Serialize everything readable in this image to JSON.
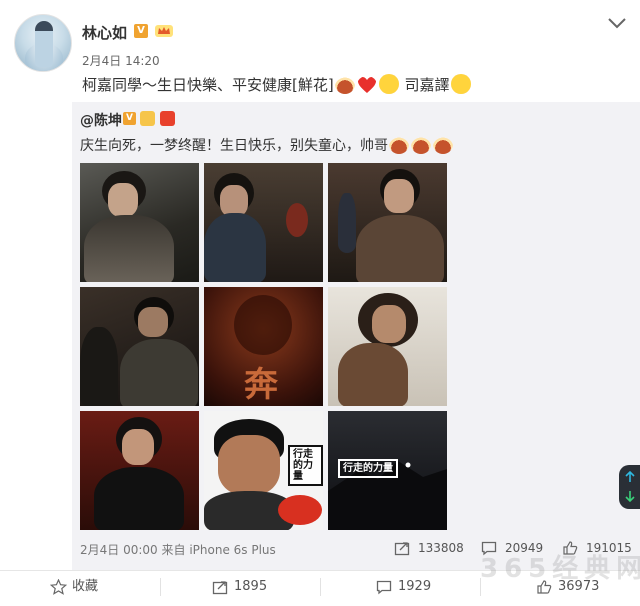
{
  "author": {
    "name": "林心如",
    "v_badge": "V",
    "time": "2月4日 14:20"
  },
  "post": {
    "text_before": "柯嘉同學～生日快樂、平安健康[鮮花]",
    "text_after": " 司嘉譯",
    "emojis": [
      "cake-emoji",
      "heart-emoji",
      "pleading-face-emoji",
      "smile-emoji"
    ]
  },
  "repost": {
    "author": "@陈坤",
    "v_badge": "V",
    "text": "庆生向死，一梦终醒！生日快乐，别失童心，帅哥",
    "emojis": [
      "cake-emoji",
      "cake-emoji",
      "cake-emoji"
    ],
    "photos": [
      {
        "name": "photo-man-in-coat"
      },
      {
        "name": "photo-man-in-suit-door"
      },
      {
        "name": "photo-man-in-tweed-suit"
      },
      {
        "name": "photo-dark-crowd-scene"
      },
      {
        "name": "photo-red-poster-character",
        "caption": "奔"
      },
      {
        "name": "photo-long-hair-portrait"
      },
      {
        "name": "photo-man-in-jacket"
      },
      {
        "name": "photo-smiling-man",
        "label": "行走的力量"
      },
      {
        "name": "photo-night-mountain",
        "label": "行走的力量"
      }
    ],
    "date": "2月4日 00:00",
    "source": "来自 iPhone 6s Plus",
    "repost_count": "133808",
    "comment_count": "20949",
    "like_count": "191015"
  },
  "actions": {
    "favorite_label": "收藏",
    "repost_count": "1895",
    "comment_count": "1929",
    "like_count": "36973"
  },
  "watermark": "365经典网",
  "colors": {
    "badge_orange": "#f0a330",
    "repost_bg": "#f2f2f5",
    "link": "#333333"
  }
}
